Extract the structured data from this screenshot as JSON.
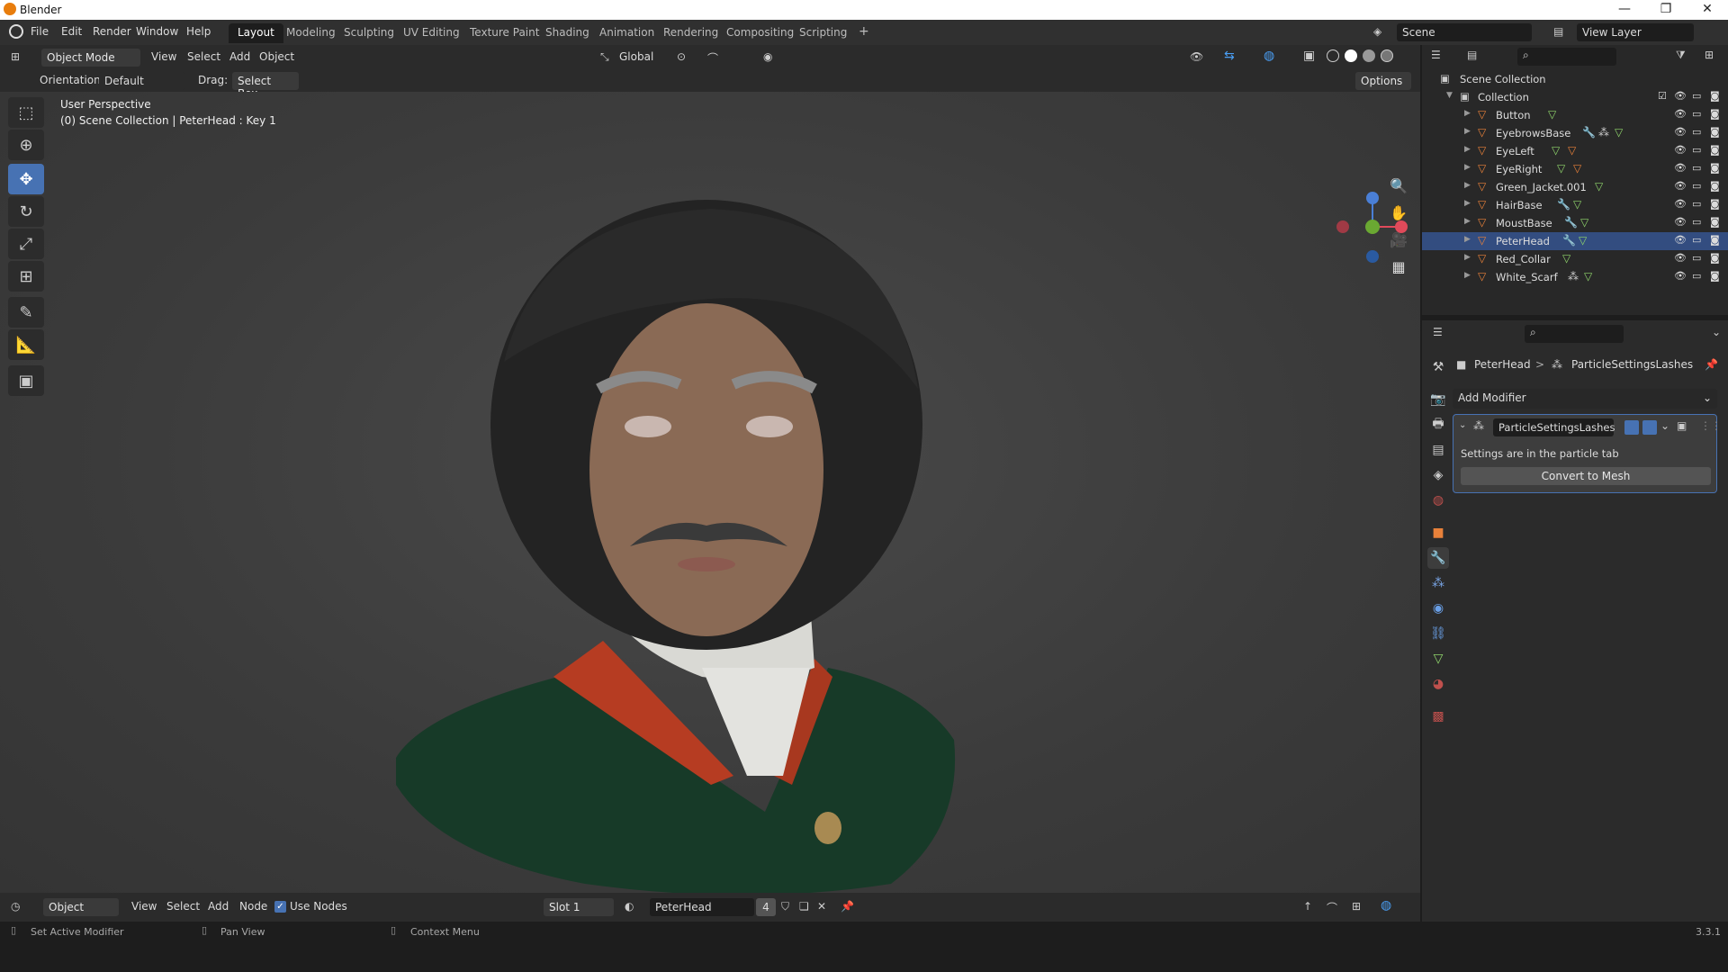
{
  "window": {
    "title": "Blender",
    "minimize": "—",
    "maximize": "❐",
    "close": "✕"
  },
  "menus": [
    "File",
    "Edit",
    "Render",
    "Window",
    "Help"
  ],
  "workspaces": [
    "Layout",
    "Modeling",
    "Sculpting",
    "UV Editing",
    "Texture Paint",
    "Shading",
    "Animation",
    "Rendering",
    "Compositing",
    "Scripting",
    "+"
  ],
  "scene": {
    "label": "Scene",
    "view_layer": "View Layer"
  },
  "viewport_header": {
    "mode": "Object Mode",
    "menus": [
      "View",
      "Select",
      "Add",
      "Object"
    ],
    "transform": "Global",
    "options": "Options"
  },
  "tool_settings": {
    "orientation_label": "Orientation:",
    "orientation_value": "Default",
    "drag_label": "Drag:",
    "drag_value": "Select Box"
  },
  "viewport": {
    "perspective": "User Perspective",
    "info": "(0) Scene Collection | PeterHead : Key 1"
  },
  "outliner": {
    "root": "Scene Collection",
    "collection": "Collection",
    "items": [
      {
        "name": "Button",
        "icons": [
          "mesh"
        ]
      },
      {
        "name": "EyebrowsBase",
        "icons": [
          "modifier",
          "particles",
          "mesh"
        ]
      },
      {
        "name": "EyeLeft",
        "icons": [
          "mesh",
          "material"
        ]
      },
      {
        "name": "EyeRight",
        "icons": [
          "mesh",
          "material"
        ]
      },
      {
        "name": "Green_Jacket.001",
        "icons": [
          "mesh"
        ]
      },
      {
        "name": "HairBase",
        "icons": [
          "modifier",
          "mesh"
        ]
      },
      {
        "name": "MoustBase",
        "icons": [
          "modifier",
          "mesh"
        ]
      },
      {
        "name": "PeterHead",
        "icons": [
          "modifier",
          "mesh"
        ]
      },
      {
        "name": "Red_Collar",
        "icons": [
          "mesh"
        ]
      },
      {
        "name": "White_Scarf",
        "icons": [
          "particles",
          "mesh"
        ]
      }
    ]
  },
  "properties": {
    "breadcrumb_object": "PeterHead",
    "breadcrumb_sep": ">",
    "breadcrumb_modifier": "ParticleSettingsLashes",
    "add_modifier": "Add Modifier",
    "modifier_name": "ParticleSettingsLashes",
    "settings_text": "Settings are in the particle tab",
    "convert_button": "Convert to Mesh"
  },
  "bottom_header": {
    "object_mode": "Object",
    "menus": [
      "View",
      "Select",
      "Add",
      "Node"
    ],
    "use_nodes": "Use Nodes",
    "slot": "Slot 1",
    "material": "PeterHead",
    "users": "4"
  },
  "status": {
    "left": "Set Active Modifier",
    "middle": "Pan View",
    "right": "Context Menu",
    "version": "3.3.1"
  },
  "colors": {
    "accent": "#4772b3",
    "object_orange": "#e8813a",
    "mesh_green": "#8fd46b"
  }
}
